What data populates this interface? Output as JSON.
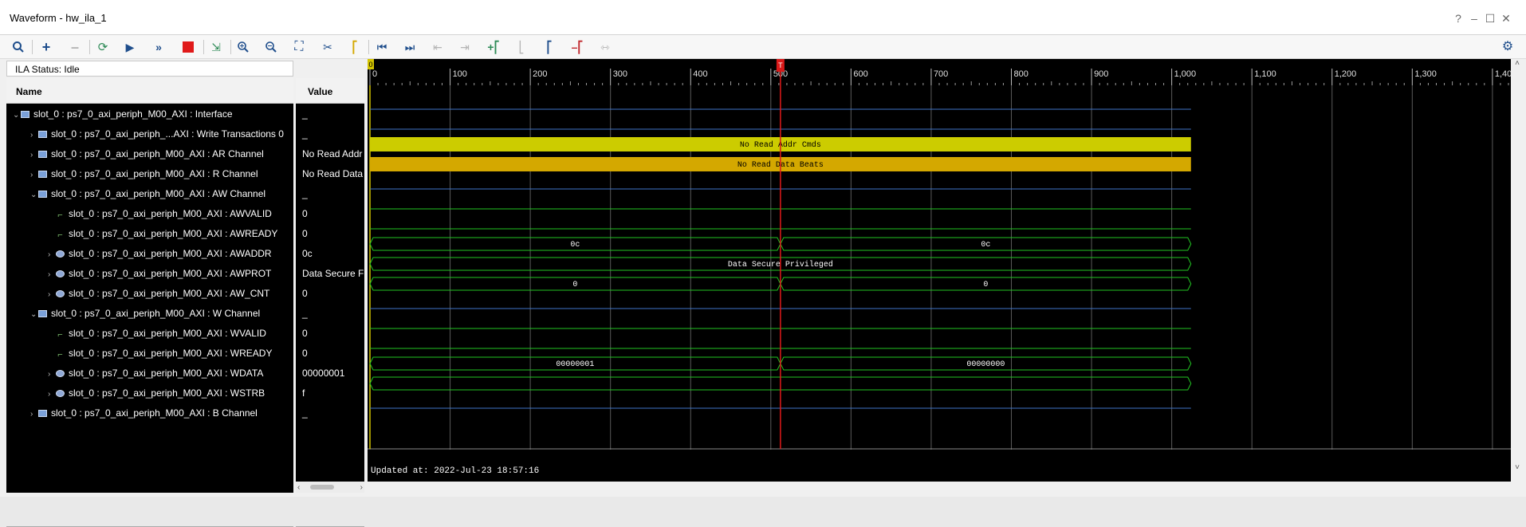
{
  "window": {
    "title": "Waveform - hw_ila_1",
    "controls": [
      "?",
      "–",
      "☐",
      "✕"
    ]
  },
  "toolbar": {
    "icons": [
      "search-icon",
      "add-icon",
      "remove-icon",
      "rerun-icon",
      "run-trigger-icon",
      "run-immediate-icon",
      "stop-icon",
      "export-icon",
      "zoom-in-icon",
      "zoom-out-icon",
      "zoom-fit-icon",
      "snap-icon",
      "add-marker-icon",
      "go-first-icon",
      "go-last-icon",
      "prev-transition-icon",
      "next-transition-icon",
      "add-cursor-icon",
      "prev-marker-icon",
      "next-marker-icon",
      "delete-marker-icon",
      "swap-icon",
      "settings-icon"
    ]
  },
  "status": {
    "text": "ILA Status:  Idle"
  },
  "name_pane": {
    "header": "Name"
  },
  "value_pane": {
    "header": "Value"
  },
  "signals": [
    {
      "name": "slot_0 : ps7_0_axi_periph_M00_AXI : Interface",
      "value": "_",
      "kind": "group",
      "indent": 0,
      "expand": "open"
    },
    {
      "name": "slot_0 : ps7_0_axi_periph_...AXI : Write Transactions 0",
      "value": "_",
      "kind": "group",
      "indent": 1,
      "expand": "closed"
    },
    {
      "name": "slot_0 : ps7_0_axi_periph_M00_AXI : AR Channel",
      "value": "No Read Addr",
      "kind": "group",
      "indent": 1,
      "expand": "closed"
    },
    {
      "name": "slot_0 : ps7_0_axi_periph_M00_AXI : R Channel",
      "value": "No Read Data",
      "kind": "group",
      "indent": 1,
      "expand": "closed"
    },
    {
      "name": "slot_0 : ps7_0_axi_periph_M00_AXI : AW Channel",
      "value": "_",
      "kind": "group",
      "indent": 1,
      "expand": "open"
    },
    {
      "name": "slot_0 : ps7_0_axi_periph_M00_AXI : AWVALID",
      "value": "0",
      "kind": "signal",
      "indent": 2,
      "expand": ""
    },
    {
      "name": "slot_0 : ps7_0_axi_periph_M00_AXI : AWREADY",
      "value": "0",
      "kind": "signal",
      "indent": 2,
      "expand": ""
    },
    {
      "name": "slot_0 : ps7_0_axi_periph_M00_AXI : AWADDR",
      "value": "0c",
      "kind": "bus",
      "indent": 2,
      "expand": "closed"
    },
    {
      "name": "slot_0 : ps7_0_axi_periph_M00_AXI : AWPROT",
      "value": "Data Secure F",
      "kind": "bus",
      "indent": 2,
      "expand": "closed"
    },
    {
      "name": "slot_0 : ps7_0_axi_periph_M00_AXI : AW_CNT",
      "value": "0",
      "kind": "bus",
      "indent": 2,
      "expand": "closed"
    },
    {
      "name": "slot_0 : ps7_0_axi_periph_M00_AXI : W Channel",
      "value": "_",
      "kind": "group",
      "indent": 1,
      "expand": "open"
    },
    {
      "name": "slot_0 : ps7_0_axi_periph_M00_AXI : WVALID",
      "value": "0",
      "kind": "signal",
      "indent": 2,
      "expand": ""
    },
    {
      "name": "slot_0 : ps7_0_axi_periph_M00_AXI : WREADY",
      "value": "0",
      "kind": "signal",
      "indent": 2,
      "expand": ""
    },
    {
      "name": "slot_0 : ps7_0_axi_periph_M00_AXI : WDATA",
      "value": "00000001",
      "kind": "bus",
      "indent": 2,
      "expand": "closed"
    },
    {
      "name": "slot_0 : ps7_0_axi_periph_M00_AXI : WSTRB",
      "value": "f",
      "kind": "bus",
      "indent": 2,
      "expand": "closed"
    },
    {
      "name": "slot_0 : ps7_0_axi_periph_M00_AXI : B Channel",
      "value": "_",
      "kind": "group",
      "indent": 1,
      "expand": "closed"
    }
  ],
  "waveform": {
    "time_axis": {
      "min": 0,
      "max": 1420,
      "ticks": [
        "0",
        "100",
        "200",
        "300",
        "400",
        "500",
        "600",
        "700",
        "800",
        "900",
        "1,000",
        "1,100",
        "1,200",
        "1,300",
        "1,400"
      ],
      "tick_values": [
        0,
        100,
        200,
        300,
        400,
        500,
        600,
        700,
        800,
        900,
        1000,
        1100,
        1200,
        1300,
        1400
      ]
    },
    "capture_end": 1024,
    "trigger_time": 512,
    "trigger_label": "T",
    "origin_marker_label": "0",
    "updated_text": "Updated at: 2022-Jul-23 18:57:16",
    "tracks": [
      {
        "type": "line"
      },
      {
        "type": "line"
      },
      {
        "type": "band",
        "color": "#cccc00",
        "label": "No Read Addr Cmds"
      },
      {
        "type": "band",
        "color": "#d4a800",
        "label": "No Read Data Beats"
      },
      {
        "type": "line"
      },
      {
        "type": "line"
      },
      {
        "type": "line"
      },
      {
        "type": "bus",
        "segments": [
          {
            "from": 0,
            "to": 512,
            "label": "0c"
          },
          {
            "from": 512,
            "to": 1024,
            "label": "0c"
          }
        ]
      },
      {
        "type": "bus",
        "segments": [
          {
            "from": 0,
            "to": 1024,
            "label": "Data Secure Privileged"
          }
        ]
      },
      {
        "type": "bus",
        "segments": [
          {
            "from": 0,
            "to": 512,
            "label": "0"
          },
          {
            "from": 512,
            "to": 1024,
            "label": "0"
          }
        ]
      },
      {
        "type": "line"
      },
      {
        "type": "line"
      },
      {
        "type": "line"
      },
      {
        "type": "bus",
        "segments": [
          {
            "from": 0,
            "to": 512,
            "label": "00000001"
          },
          {
            "from": 512,
            "to": 1024,
            "label": "00000000"
          }
        ]
      },
      {
        "type": "bus",
        "segments": [
          {
            "from": 0,
            "to": 1024,
            "label": ""
          }
        ]
      },
      {
        "type": "line"
      }
    ]
  }
}
